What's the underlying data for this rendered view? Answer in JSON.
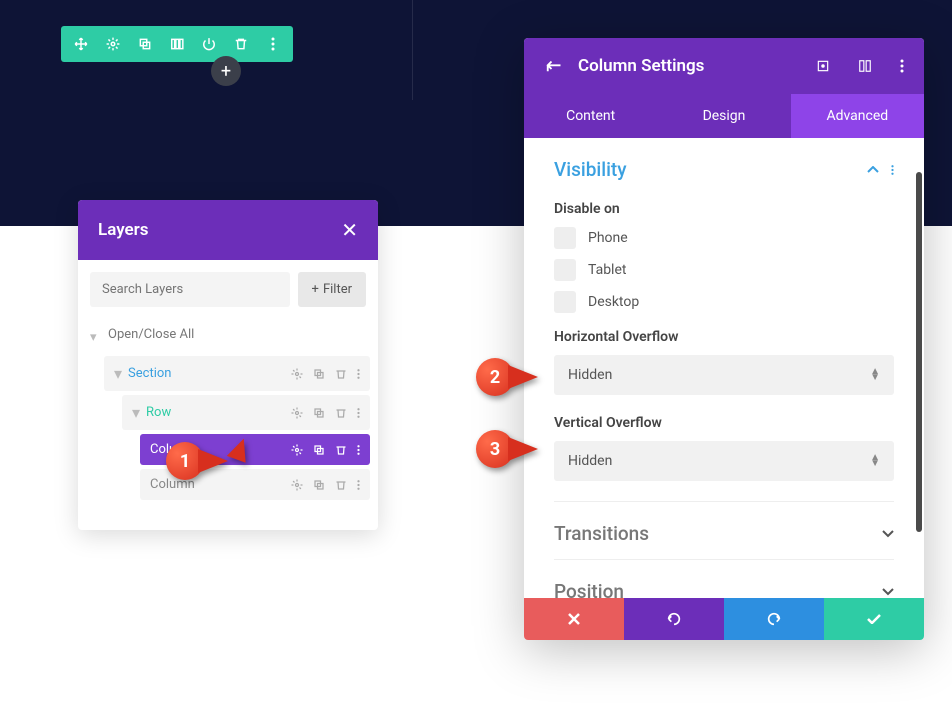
{
  "layers_panel": {
    "title": "Layers",
    "search_placeholder": "Search Layers",
    "filter_label": "Filter",
    "open_close_all": "Open/Close All",
    "items": {
      "section": "Section",
      "row": "Row",
      "column_active": "Column",
      "column": "Column"
    }
  },
  "settings_panel": {
    "title": "Column Settings",
    "tabs": {
      "content": "Content",
      "design": "Design",
      "advanced": "Advanced"
    },
    "visibility": {
      "title": "Visibility",
      "disable_on_label": "Disable on",
      "phone": "Phone",
      "tablet": "Tablet",
      "desktop": "Desktop",
      "horizontal_overflow_label": "Horizontal Overflow",
      "horizontal_overflow_value": "Hidden",
      "vertical_overflow_label": "Vertical Overflow",
      "vertical_overflow_value": "Hidden"
    },
    "transitions_title": "Transitions",
    "position_title": "Position"
  },
  "badges": {
    "b1": "1",
    "b2": "2",
    "b3": "3"
  }
}
